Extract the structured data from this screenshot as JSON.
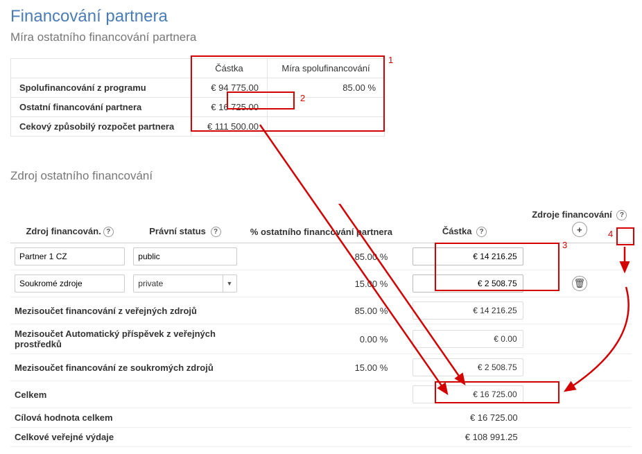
{
  "page": {
    "title": "Financování partnera",
    "subtitle": "Míra ostatního financování partnera",
    "subtitle2": "Zdroj ostatního financování"
  },
  "summary": {
    "col_amount": "Částka",
    "col_rate": "Míra spolufinancování",
    "rows": [
      {
        "label": "Spolufinancování z programu",
        "amount": "€ 94 775.00",
        "rate": "85.00 %"
      },
      {
        "label": "Ostatní financování partnera",
        "amount": "€ 16 725.00",
        "rate": ""
      },
      {
        "label": "Cekový způsobilý rozpočet partnera",
        "amount": "€ 111 500.00",
        "rate": ""
      }
    ]
  },
  "annot": {
    "n1": "1",
    "n2": "2",
    "n3": "3",
    "n4": "4"
  },
  "sources": {
    "headers": {
      "source": "Zdroj financován.",
      "legal": "Právní status",
      "pct": "% ostatního financování partnera",
      "amount": "Částka",
      "resources": "Zdroje financování",
      "help": "?"
    },
    "rows": [
      {
        "source": "Partner 1 CZ",
        "legal": "public",
        "pct": "85.00 %",
        "amount": "€ 14 216.25"
      },
      {
        "source": "Soukromé zdroje",
        "legal": "private",
        "pct": "15.00 %",
        "amount": "€ 2 508.75"
      }
    ],
    "subtotals": [
      {
        "label": "Mezisoučet financování z veřejných zdrojů",
        "pct": "85.00 %",
        "amount": "€ 14 216.25"
      },
      {
        "label": "Mezisoučet Automatický příspěvek z veřejných prostředků",
        "pct": "0.00 %",
        "amount": "€ 0.00"
      },
      {
        "label": "Mezisoučet financování ze soukromých zdrojů",
        "pct": "15.00 %",
        "amount": "€ 2 508.75"
      }
    ],
    "totals": [
      {
        "label": "Celkem",
        "amount": "€ 16 725.00"
      },
      {
        "label": "Cílová hodnota celkem",
        "amount": "€ 16 725.00"
      },
      {
        "label": "Celkové veřejné výdaje",
        "amount": "€ 108 991.25"
      }
    ],
    "icons": {
      "add": "+",
      "trash": "🗑"
    }
  }
}
